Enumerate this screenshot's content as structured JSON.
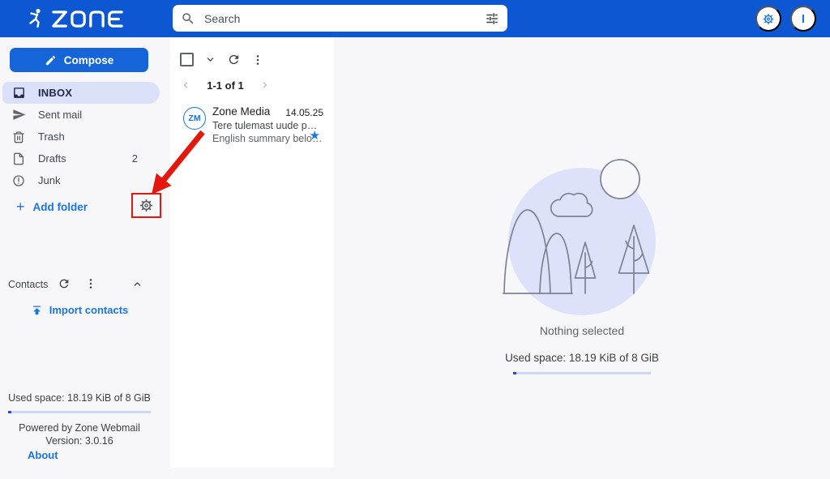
{
  "header": {
    "logo_text": "ZONE",
    "search": {
      "placeholder": "Search"
    },
    "avatar_initial": "I"
  },
  "sidebar": {
    "compose_label": "Compose",
    "folders": [
      {
        "label": "INBOX",
        "selected": true
      },
      {
        "label": "Sent mail"
      },
      {
        "label": "Trash"
      },
      {
        "label": "Drafts",
        "count": "2"
      },
      {
        "label": "Junk"
      }
    ],
    "add_folder_label": "Add folder",
    "contacts": {
      "title": "Contacts",
      "import_label": "Import contacts"
    },
    "usage": {
      "used_space": "Used space: 18.19 KiB of 8 GiB"
    },
    "powered_by": "Powered by Zone Webmail",
    "version": "Version: 3.0.16",
    "about_label": "About"
  },
  "mail_list": {
    "pagination": "1-1 of 1",
    "emails": [
      {
        "avatar_initials": "ZM",
        "sender": "Zone Media",
        "date": "14.05.25",
        "subject": "Tere tulemast uude p…",
        "preview": "English summary belo…",
        "starred": true
      }
    ]
  },
  "main": {
    "empty_state": "Nothing selected",
    "used_space": "Used space: 18.19 KiB of 8 GiB"
  },
  "icons": {
    "plus": "+",
    "star": "★"
  },
  "colors": {
    "header_blue": "#0d57d2",
    "compose_blue": "#1565d8",
    "accent_blue": "#1a73e8",
    "selected_row_bg": "#d9e0f8",
    "annotation_red": "#e3170c",
    "illustration_fill": "#dde2fa"
  }
}
